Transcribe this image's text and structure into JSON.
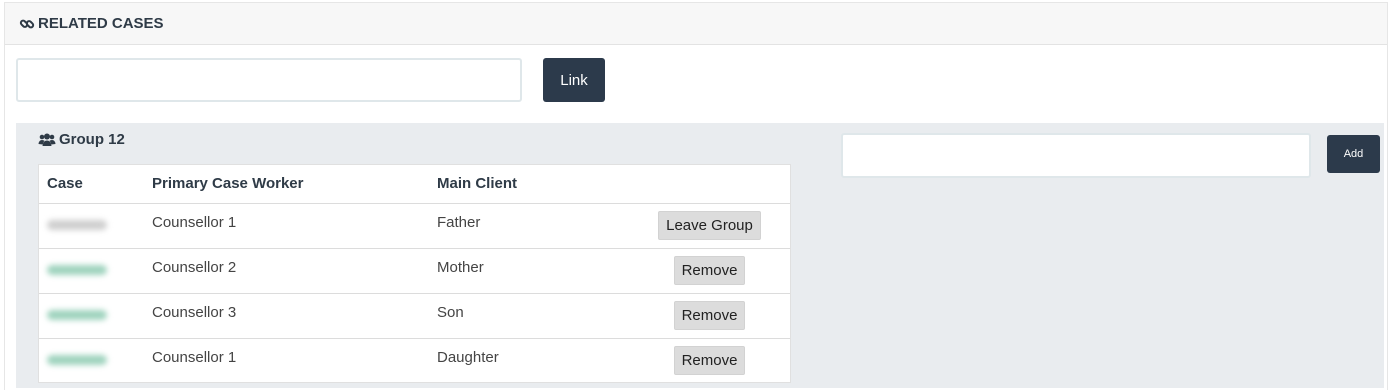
{
  "panel": {
    "title": "RELATED CASES",
    "icon": "link-icon"
  },
  "link_form": {
    "input_value": "",
    "button_label": "Link"
  },
  "group": {
    "title": "Group 12",
    "icon": "users-icon",
    "columns": [
      "Case",
      "Primary Case Worker",
      "Main Client",
      ""
    ],
    "rows": [
      {
        "case": "",
        "worker": "Counsellor 1",
        "client": "Father",
        "action": "Leave Group"
      },
      {
        "case": "",
        "worker": "Counsellor 2",
        "client": "Mother",
        "action": "Remove"
      },
      {
        "case": "",
        "worker": "Counsellor 3",
        "client": "Son",
        "action": "Remove"
      },
      {
        "case": "",
        "worker": "Counsellor 1",
        "client": "Daughter",
        "action": "Remove"
      }
    ]
  },
  "add_form": {
    "input_value": "",
    "button_label": "Add"
  },
  "colors": {
    "dark_button": "#2c3a4b",
    "group_background": "#e9ecef",
    "heading_text": "#2f3b47"
  }
}
